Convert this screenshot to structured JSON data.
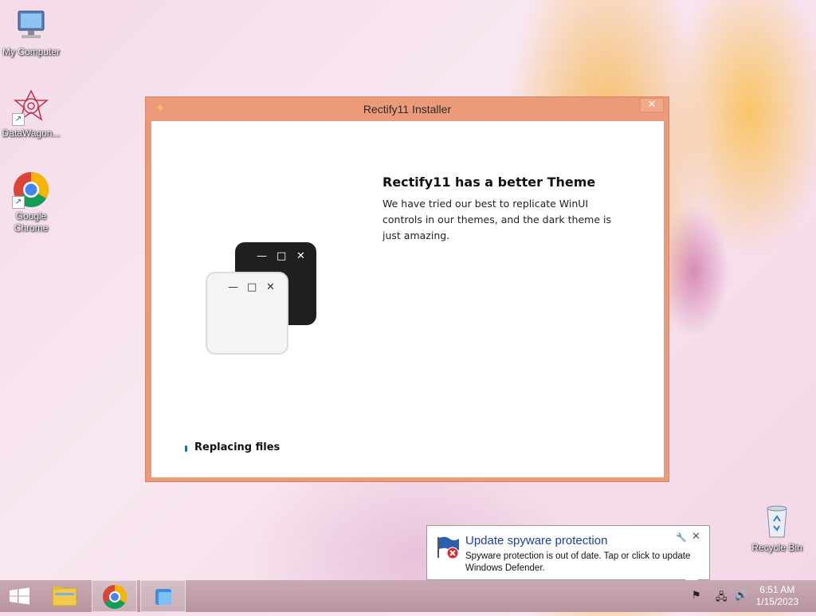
{
  "desktop": {
    "icons": [
      {
        "label": "My Computer"
      },
      {
        "label": "DataWagon..."
      },
      {
        "label": "Google Chrome"
      },
      {
        "label": "Recycle Bin"
      }
    ]
  },
  "installer": {
    "title": "Rectify11 Installer",
    "close_glyph": "✕",
    "heading": "Rectify11 has a better Theme",
    "description": "We have tried our best to replicate WinUI controls in our themes, and the dark theme is just amazing.",
    "status": "Replacing files",
    "mini_controls": {
      "minimize": "—",
      "maximize": "□",
      "close": "✕"
    }
  },
  "notification": {
    "title": "Update spyware protection",
    "text": "Spyware protection is out of date. Tap or click to update Windows Defender.",
    "settings_glyph": "🔧",
    "close_glyph": "✕"
  },
  "taskbar": {
    "clock_time": "6:51 AM",
    "clock_date": "1/15/2023"
  },
  "colors": {
    "window_frame": "#eb9b7a",
    "balloon_title": "#1c3fa4"
  }
}
